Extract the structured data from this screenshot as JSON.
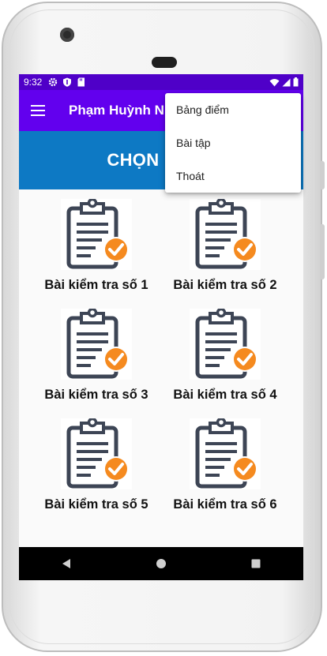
{
  "status_bar": {
    "time": "9:32",
    "left_icons": [
      "gear-icon",
      "shield-icon",
      "sd-card-icon"
    ],
    "right_icons": [
      "wifi-icon",
      "signal-icon",
      "battery-icon"
    ]
  },
  "app_bar": {
    "title": "Phạm Huỳnh Nh",
    "nav_icon": "hamburger-menu-icon",
    "color": "#6200ee"
  },
  "banner": {
    "title": "CHỌN BÀI",
    "color": "#0d79c4"
  },
  "quizzes": [
    {
      "label": "Bài kiểm tra số 1"
    },
    {
      "label": "Bài kiểm tra số 2"
    },
    {
      "label": "Bài kiểm tra số 3"
    },
    {
      "label": "Bài kiểm tra số 4"
    },
    {
      "label": "Bài kiểm tra số 5"
    },
    {
      "label": "Bài kiểm tra số 6"
    }
  ],
  "quiz_icon": {
    "name": "clipboard-check-icon",
    "clipboard_color": "#3d4555",
    "check_color": "#f58a1f"
  },
  "overflow_menu": {
    "items": [
      "Bảng điểm",
      "Bài tập",
      "Thoát"
    ]
  },
  "nav_bar": {
    "buttons": [
      "back-icon",
      "home-icon",
      "recents-icon"
    ]
  }
}
